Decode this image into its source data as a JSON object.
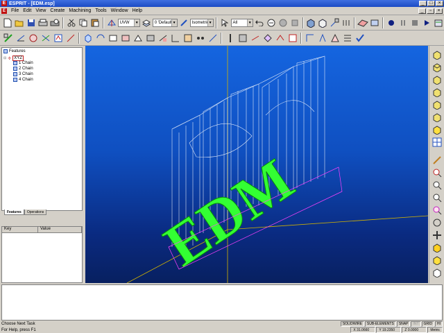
{
  "window": {
    "title": "ESPRIT - [EDM.esp]",
    "app_logo": "E"
  },
  "menu": [
    "File",
    "Edit",
    "View",
    "Create",
    "Machining",
    "Tools",
    "Window",
    "Help"
  ],
  "toolbar": {
    "plane_combo": "UVW",
    "layer_combo": "0 'Default'",
    "view_combo": "Isometric",
    "filter_combo": "All"
  },
  "feature_tree": {
    "root": "Features",
    "origin": "XYZ",
    "items": [
      "1 Chain",
      "2 Chain",
      "3 Chain",
      "4 Chain"
    ]
  },
  "tabs": {
    "features": "Features",
    "operations": "Operations"
  },
  "properties": {
    "key_header": "Key",
    "value_header": "Value"
  },
  "viewport": {
    "model_text": "EDM"
  },
  "status": {
    "command_line": "Choose Next Task",
    "help": "For Help, press F1",
    "modes": [
      "SOLIDWIRE",
      "SUB-ELEMENTS",
      "SNAP",
      "INT",
      "GRID",
      "HI"
    ],
    "coords": {
      "x": "X 31.0660",
      "y": "Y 19.2350",
      "z": "Z 0.0000",
      "units": "Metric"
    }
  },
  "colors": {
    "viewport_top": "#1565e0",
    "viewport_bottom": "#082060",
    "model_face": "#33ff33",
    "wireframe": "#ffffff",
    "chain_edge": "#ff40ff",
    "axis": "#d4b400"
  }
}
